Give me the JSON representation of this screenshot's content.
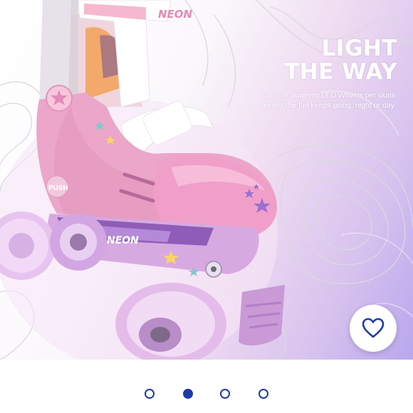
{
  "promo": {
    "headline_line1": "LIGHT",
    "headline_line2": "THE WAY",
    "subtitle": "Two self powered LED Wheels per skate means the fun keeps going, night or day.",
    "brand_mark": "NEON",
    "push_label": "PUSH"
  },
  "favorite": {
    "icon": "heart-icon"
  },
  "carousel": {
    "slide_count": 4,
    "active_index": 1
  },
  "colors": {
    "accent": "#1e3aa8",
    "skate_pink": "#e9a3c9",
    "wheel_purple": "#c49ad8"
  }
}
